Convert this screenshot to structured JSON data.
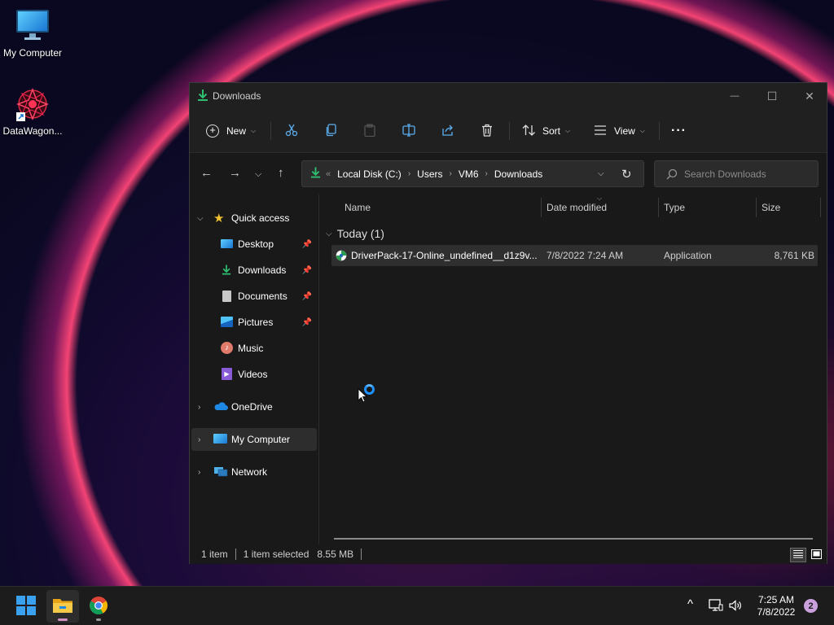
{
  "desktop": {
    "icons": [
      {
        "label": "My Computer",
        "icon": "monitor-icon"
      },
      {
        "label": "DataWagon...",
        "icon": "datawagon-app-icon"
      }
    ]
  },
  "window": {
    "title": "Downloads",
    "controls": {
      "minimize": "—",
      "maximize": "☐",
      "close": "✕"
    },
    "toolbar": {
      "new_label": "New",
      "sort_label": "Sort",
      "view_label": "View",
      "more_label": "···"
    },
    "address": {
      "overflow": "«",
      "crumbs": [
        "Local Disk (C:)",
        "Users",
        "VM6",
        "Downloads"
      ],
      "search_placeholder": "Search Downloads"
    },
    "sidebar": {
      "quick_access": "Quick access",
      "items": [
        {
          "label": "Desktop",
          "pinned": true
        },
        {
          "label": "Downloads",
          "pinned": true
        },
        {
          "label": "Documents",
          "pinned": true
        },
        {
          "label": "Pictures",
          "pinned": true
        },
        {
          "label": "Music",
          "pinned": false
        },
        {
          "label": "Videos",
          "pinned": false
        }
      ],
      "onedrive": "OneDrive",
      "my_computer": "My Computer",
      "network": "Network"
    },
    "columns": {
      "name": "Name",
      "date": "Date modified",
      "type": "Type",
      "size": "Size"
    },
    "group_label": "Today (1)",
    "files": [
      {
        "name": "DriverPack-17-Online_undefined__d1z9v...",
        "date": "7/8/2022 7:24 AM",
        "type": "Application",
        "size": "8,761 KB"
      }
    ],
    "status": {
      "items": "1 item",
      "selected": "1 item selected",
      "size": "8.55 MB"
    }
  },
  "taskbar": {
    "time": "7:25 AM",
    "date": "7/8/2022",
    "notification_count": "2"
  },
  "colors": {
    "accent": "#0078d4",
    "window_bg": "#191919",
    "taskbar_bg": "#1c1c1c"
  }
}
